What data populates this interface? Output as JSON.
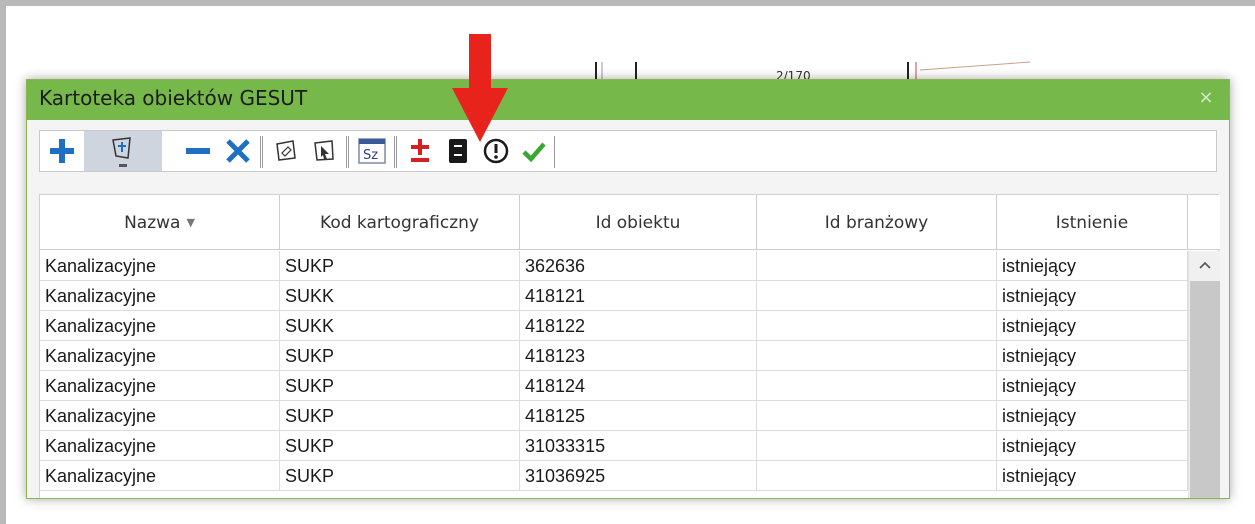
{
  "background": {
    "map_label": "2/170"
  },
  "dialog": {
    "title": "Kartoteka obiektów GESUT",
    "close_glyph": "×"
  },
  "toolbar": {
    "buttons": [
      {
        "name": "add-icon",
        "label": "+"
      },
      {
        "name": "edit-geometry-icon",
        "label": ""
      },
      {
        "name": "remove-icon",
        "label": "−"
      },
      {
        "name": "delete-icon",
        "label": "✕"
      },
      {
        "name": "draw-polygon-icon",
        "label": ""
      },
      {
        "name": "select-polygon-icon",
        "label": ""
      },
      {
        "name": "sz-icon",
        "label": "Sz"
      },
      {
        "name": "plus-minus-icon",
        "label": "±"
      },
      {
        "name": "cabinet-icon",
        "label": ""
      },
      {
        "name": "warning-icon",
        "label": "!"
      },
      {
        "name": "confirm-check-icon",
        "label": "✔"
      }
    ]
  },
  "grid": {
    "columns": [
      "Nazwa",
      "Kod kartograficzny",
      "Id obiektu",
      "Id branżowy",
      "Istnienie"
    ],
    "sort_indicator": "▼",
    "rows": [
      [
        "Kanalizacyjne",
        "SUKP",
        "362636",
        "",
        "istniejący"
      ],
      [
        "Kanalizacyjne",
        "SUKK",
        "418121",
        "",
        "istniejący"
      ],
      [
        "Kanalizacyjne",
        "SUKK",
        "418122",
        "",
        "istniejący"
      ],
      [
        "Kanalizacyjne",
        "SUKP",
        "418123",
        "",
        "istniejący"
      ],
      [
        "Kanalizacyjne",
        "SUKP",
        "418124",
        "",
        "istniejący"
      ],
      [
        "Kanalizacyjne",
        "SUKP",
        "418125",
        "",
        "istniejący"
      ],
      [
        "Kanalizacyjne",
        "SUKP",
        "31033315",
        "",
        "istniejący"
      ],
      [
        "Kanalizacyjne",
        "SUKP",
        "31036925",
        "",
        "istniejący"
      ]
    ],
    "scroll_up_glyph": "^"
  },
  "colors": {
    "titlebar": "#76b94a",
    "annotation_arrow": "#e8231c",
    "add_blue": "#1f6fc4",
    "plus_minus_red": "#d42020",
    "check_green": "#3aa635"
  }
}
